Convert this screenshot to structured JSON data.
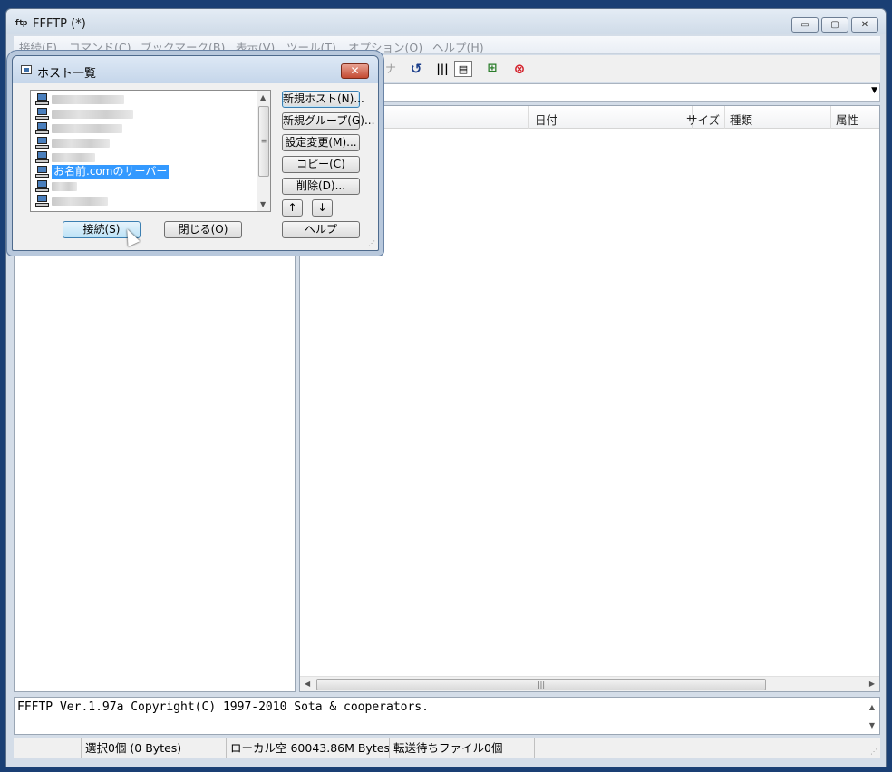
{
  "window": {
    "title": "FFFTP (*)",
    "app_icon_text": "ftp",
    "minimize": "▭",
    "maximize": "▢",
    "close": "✕"
  },
  "menu": [
    "接続(F)",
    "コマンド(C)",
    "ブックマーク(B)",
    "表示(V)",
    "ツール(T)",
    "オプション(O)",
    "ヘルプ(H)"
  ],
  "toolbar": {
    "kana_label": "カナ",
    "icons": [
      "refresh-icon",
      "list-view-icon",
      "detail-view-icon",
      "tree-icon",
      "stop-icon"
    ]
  },
  "remote_list": {
    "columns": [
      "日付",
      "サイズ",
      "種類",
      "属性"
    ]
  },
  "log": {
    "text": "FFFTP Ver.1.97a Copyright(C) 1997-2010 Sota & cooperators."
  },
  "status": {
    "selected": "選択0個 (0 Bytes)",
    "local_free": "ローカル空 60043.86M Bytes",
    "transfer_queue": "転送待ちファイル0個"
  },
  "dialog": {
    "title": "ホスト一覧",
    "close": "✕",
    "selected_host": "お名前.comのサーバー",
    "buttons": {
      "new_host": "新規ホスト(N)...",
      "new_group": "新規グループ(G)...",
      "edit": "設定変更(M)...",
      "copy": "コピー(C)",
      "delete": "削除(D)...",
      "up": "↑",
      "down": "↓",
      "connect": "接続(S)",
      "close_dialog": "閉じる(O)",
      "help": "ヘルプ"
    }
  }
}
